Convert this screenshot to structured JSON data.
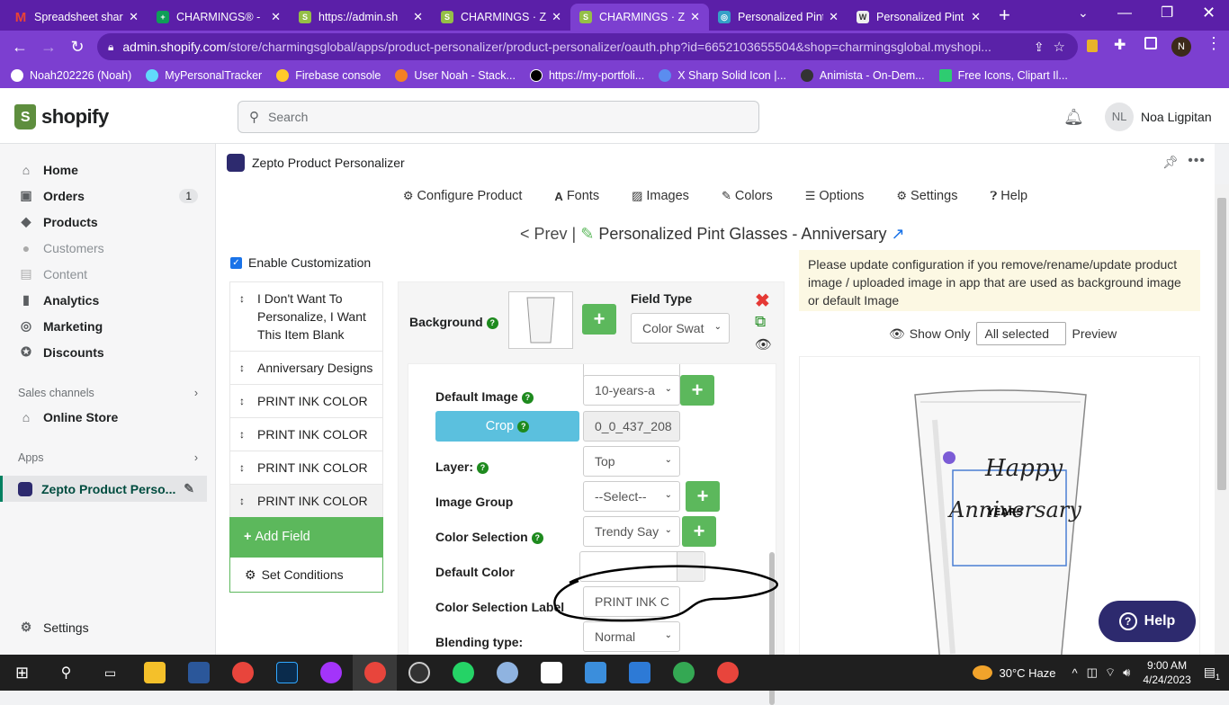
{
  "browser": {
    "tabs": [
      {
        "title": "Spreadsheet shar",
        "icon": "gmail-icon",
        "color": "#ea4335"
      },
      {
        "title": "CHARMINGS® -",
        "icon": "sheets-icon",
        "color": "#0f9d58"
      },
      {
        "title": "https://admin.sh",
        "icon": "shopify-icon",
        "color": "#5e8e3e"
      },
      {
        "title": "CHARMINGS · Ze",
        "icon": "shopify-icon",
        "color": "#5e8e3e"
      },
      {
        "title": "CHARMINGS · Ze",
        "icon": "shopify-icon",
        "color": "#5e8e3e"
      },
      {
        "title": "Personalized Pint",
        "icon": "page-icon",
        "color": "#35a0c8"
      },
      {
        "title": "Personalized Pint",
        "icon": "wordpress-icon",
        "color": "#555"
      }
    ],
    "new_tab": "+",
    "url_host": "admin.shopify.com",
    "url_path": "/store/charmingsglobal/apps/product-personalizer/product-personalizer/oauth.php?id=6652103655504&shop=charmingsglobal.myshopi...",
    "profile_initial": "N",
    "bookmarks": [
      {
        "label": "Noah202226 (Noah)",
        "color": "#fff"
      },
      {
        "label": "MyPersonalTracker",
        "color": "#61dafb"
      },
      {
        "label": "Firebase console",
        "color": "#ffca28"
      },
      {
        "label": "User Noah - Stack...",
        "color": "#f48024"
      },
      {
        "label": "https://my-portfoli...",
        "color": "#000"
      },
      {
        "label": "X Sharp Solid Icon |...",
        "color": "#5b8def"
      },
      {
        "label": "Animista - On-Dem...",
        "color": "#333"
      },
      {
        "label": "Free Icons, Clipart Il...",
        "color": "#2ecc71"
      }
    ]
  },
  "shopify": {
    "logo_text": "shopify",
    "search_placeholder": "Search",
    "user_initials": "NL",
    "user_name": "Noa Ligpitan",
    "nav": [
      {
        "label": "Home",
        "icon": "home-icon"
      },
      {
        "label": "Orders",
        "icon": "orders-icon",
        "badge": "1"
      },
      {
        "label": "Products",
        "icon": "tag-icon"
      },
      {
        "label": "Customers",
        "icon": "person-icon"
      },
      {
        "label": "Content",
        "icon": "content-icon"
      },
      {
        "label": "Analytics",
        "icon": "analytics-icon"
      },
      {
        "label": "Marketing",
        "icon": "marketing-icon"
      },
      {
        "label": "Discounts",
        "icon": "discount-icon"
      }
    ],
    "sales_channels_label": "Sales channels",
    "online_store_label": "Online Store",
    "apps_label": "Apps",
    "app_item_label": "Zepto Product Perso...",
    "settings_label": "Settings"
  },
  "app": {
    "name": "Zepto Product Personalizer",
    "menu": [
      "Configure Product",
      "Fonts",
      "Images",
      "Colors",
      "Options",
      "Settings",
      "Help"
    ],
    "prev_label": "< Prev |",
    "product_title": "Personalized Pint Glasses - Anniversary",
    "enable_label": "Enable Customization",
    "fields": [
      "I Don't Want To Personalize, I Want This Item Blank",
      "Anniversary Designs",
      "PRINT INK COLOR",
      "PRINT INK COLOR",
      "PRINT INK COLOR",
      "PRINT INK COLOR"
    ],
    "add_field_label": "Add Field",
    "set_conditions_label": "Set Conditions",
    "config": {
      "background_label": "Background",
      "field_type_label": "Field Type",
      "field_type_value": "Color Swat",
      "default_image_label": "Default Image",
      "default_image_value": "10-years-a",
      "crop_label": "Crop",
      "crop_value": "0_0_437_208",
      "layer_label": "Layer:",
      "layer_value": "Top",
      "image_group_label": "Image Group",
      "image_group_value": "--Select--",
      "color_selection_label": "Color Selection",
      "color_selection_value": "Trendy Say",
      "default_color_label": "Default Color",
      "color_selection_label_label": "Color Selection Label",
      "color_selection_label_value": "PRINT INK C",
      "blending_label": "Blending type:",
      "blending_value": "Normal"
    },
    "notice": "Please update configuration if you remove/rename/update product image / uploaded image in app that are used as background image or default Image",
    "show_only_label": "Show Only",
    "all_selected": "All selected",
    "preview_label": "Preview",
    "preview_text_happy": "Happy",
    "preview_text_anniv": "Anniversary",
    "preview_text_years": "YEARS",
    "help_label": "Help"
  },
  "taskbar": {
    "weather": "30°C  Haze",
    "time": "9:00 AM",
    "date": "4/24/2023",
    "notifications": "1"
  }
}
